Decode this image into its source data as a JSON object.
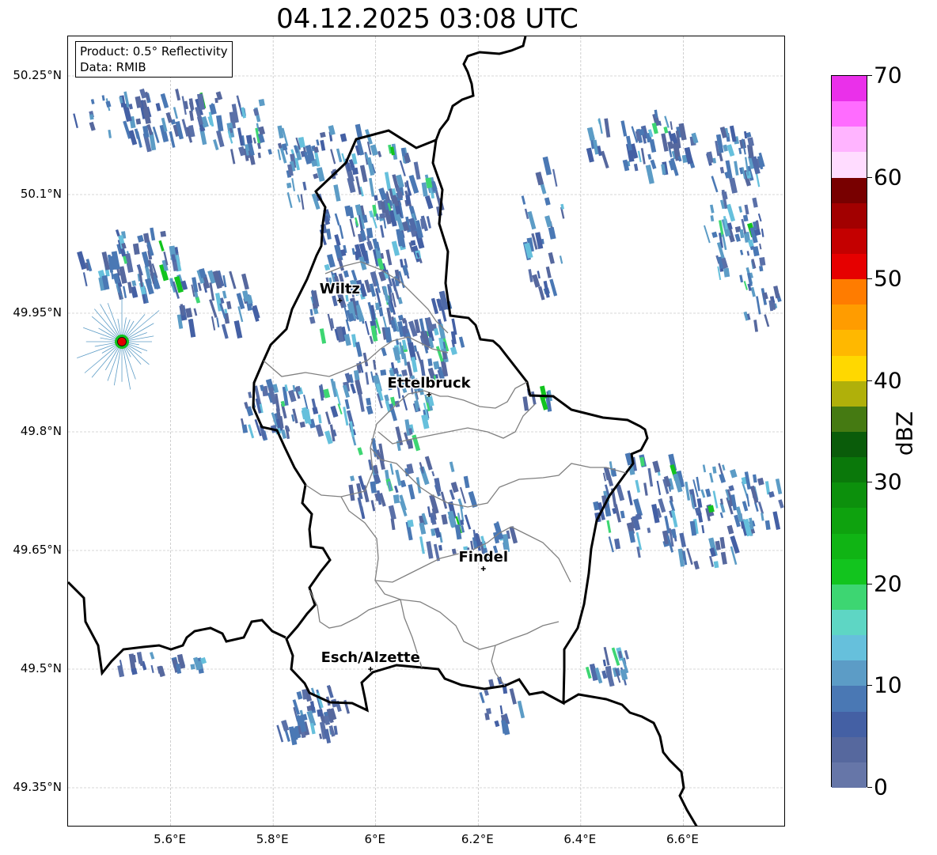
{
  "title": "04.12.2025 03:08 UTC",
  "info_box": {
    "product": "Product: 0.5° Reflectivity",
    "data": "Data: RMIB"
  },
  "map": {
    "lon_range": [
      5.4,
      6.8
    ],
    "lat_range": [
      49.3,
      50.3
    ],
    "lat_ticks": [
      {
        "value": 50.25,
        "label": "50.25°N"
      },
      {
        "value": 50.1,
        "label": "50.1°N"
      },
      {
        "value": 49.95,
        "label": "49.95°N"
      },
      {
        "value": 49.8,
        "label": "49.8°N"
      },
      {
        "value": 49.65,
        "label": "49.65°N"
      },
      {
        "value": 49.5,
        "label": "49.5°N"
      },
      {
        "value": 49.35,
        "label": "49.35°N"
      }
    ],
    "lon_ticks": [
      {
        "value": 5.6,
        "label": "5.6°E"
      },
      {
        "value": 5.8,
        "label": "5.8°E"
      },
      {
        "value": 6.0,
        "label": "6°E"
      },
      {
        "value": 6.2,
        "label": "6.2°E"
      },
      {
        "value": 6.4,
        "label": "6.4°E"
      },
      {
        "value": 6.6,
        "label": "6.6°E"
      }
    ],
    "grid": true,
    "cities": [
      {
        "name": "Wiltz",
        "lon": 5.93,
        "lat": 49.966
      },
      {
        "name": "Ettelbruck",
        "lon": 6.104,
        "lat": 49.847
      },
      {
        "name": "Findel",
        "lon": 6.21,
        "lat": 49.627
      },
      {
        "name": "Esch/Alzette",
        "lon": 5.99,
        "lat": 49.5
      }
    ],
    "radar_site": {
      "lon": 5.505,
      "lat": 49.914,
      "color": "#e00000"
    }
  },
  "colorbar": {
    "unit": "dBZ",
    "min": 0,
    "max": 70,
    "ticks": [
      {
        "value": 0,
        "label": "0"
      },
      {
        "value": 10,
        "label": "10"
      },
      {
        "value": 20,
        "label": "20"
      },
      {
        "value": 30,
        "label": "30"
      },
      {
        "value": 40,
        "label": "40"
      },
      {
        "value": 50,
        "label": "50"
      },
      {
        "value": 60,
        "label": "60"
      },
      {
        "value": 70,
        "label": "70"
      }
    ],
    "colors": [
      "#6676a8",
      "#56689e",
      "#4460a4",
      "#4a78b4",
      "#5c9cc6",
      "#66c0dc",
      "#5ed6c4",
      "#3dd672",
      "#12c41e",
      "#10b414",
      "#0ea20e",
      "#0c900c",
      "#0a780a",
      "#0a5c0a",
      "#457a12",
      "#b0b00a",
      "#ffd800",
      "#ffb800",
      "#ff9c00",
      "#ff7c00",
      "#e60000",
      "#c40000",
      "#a20000",
      "#780000",
      "#ffdcff",
      "#ffb4ff",
      "#ff6cff",
      "#ea30ea"
    ]
  }
}
